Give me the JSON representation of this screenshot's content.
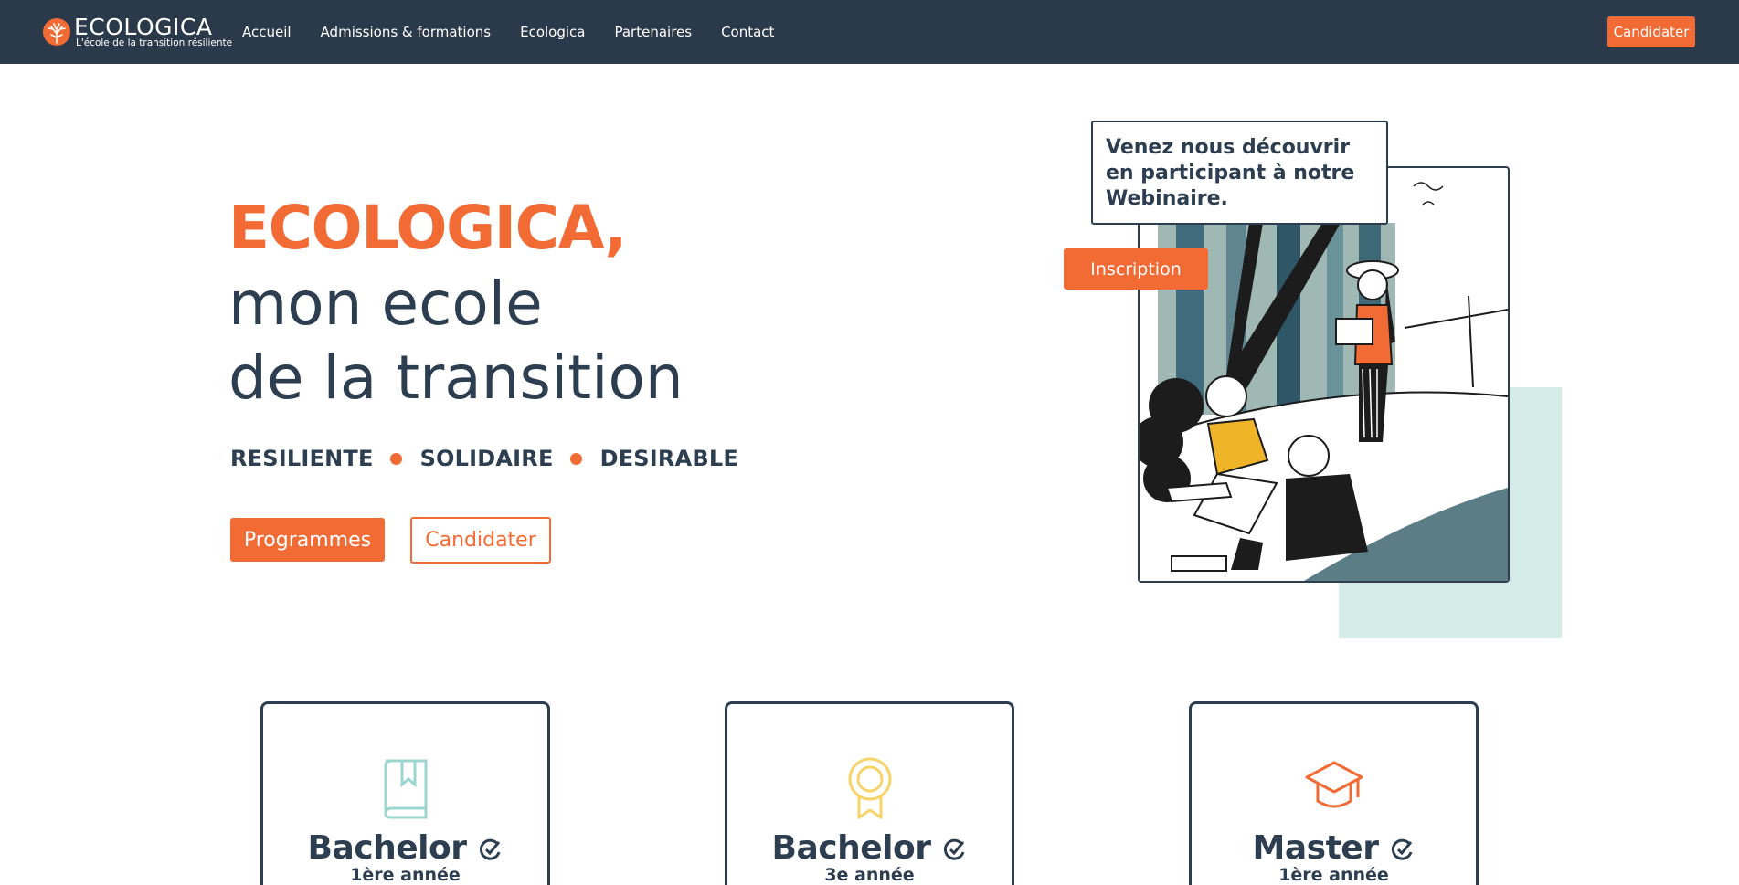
{
  "brand": {
    "name": "ECOLOGICA",
    "tagline": "L'école de la transition résiliente",
    "accent_color": "#f26b35",
    "navbar_color": "#2b3a4a",
    "text_color": "#2d3e50",
    "teal_color": "#d4ebe8"
  },
  "nav": {
    "items": [
      {
        "label": "Accueil"
      },
      {
        "label": "Admissions & formations"
      },
      {
        "label": "Ecologica"
      },
      {
        "label": "Partenaires"
      },
      {
        "label": "Contact"
      }
    ],
    "cta_label": "Candidater"
  },
  "hero": {
    "title": "ECOLOGICA,",
    "line1": "mon ecole",
    "line2": "de la transition",
    "tags": [
      "RESILIENTE",
      "SOLIDAIRE",
      "DESIRABLE"
    ],
    "primary_button": "Programmes",
    "secondary_button": "Candidater"
  },
  "webinar": {
    "text": "Venez nous découvrir en participant à notre Webinaire.",
    "button": "Inscription"
  },
  "programs": [
    {
      "title": "Bachelor",
      "subtitle": "1ère année",
      "icon": "book-icon",
      "icon_color": "#9dd5cf"
    },
    {
      "title": "Bachelor",
      "subtitle": "3e année",
      "icon": "medal-icon",
      "icon_color": "#f7d46a"
    },
    {
      "title": "Master",
      "subtitle": "1ère année",
      "icon": "graduation-cap-icon",
      "icon_color": "#f26b35"
    }
  ]
}
